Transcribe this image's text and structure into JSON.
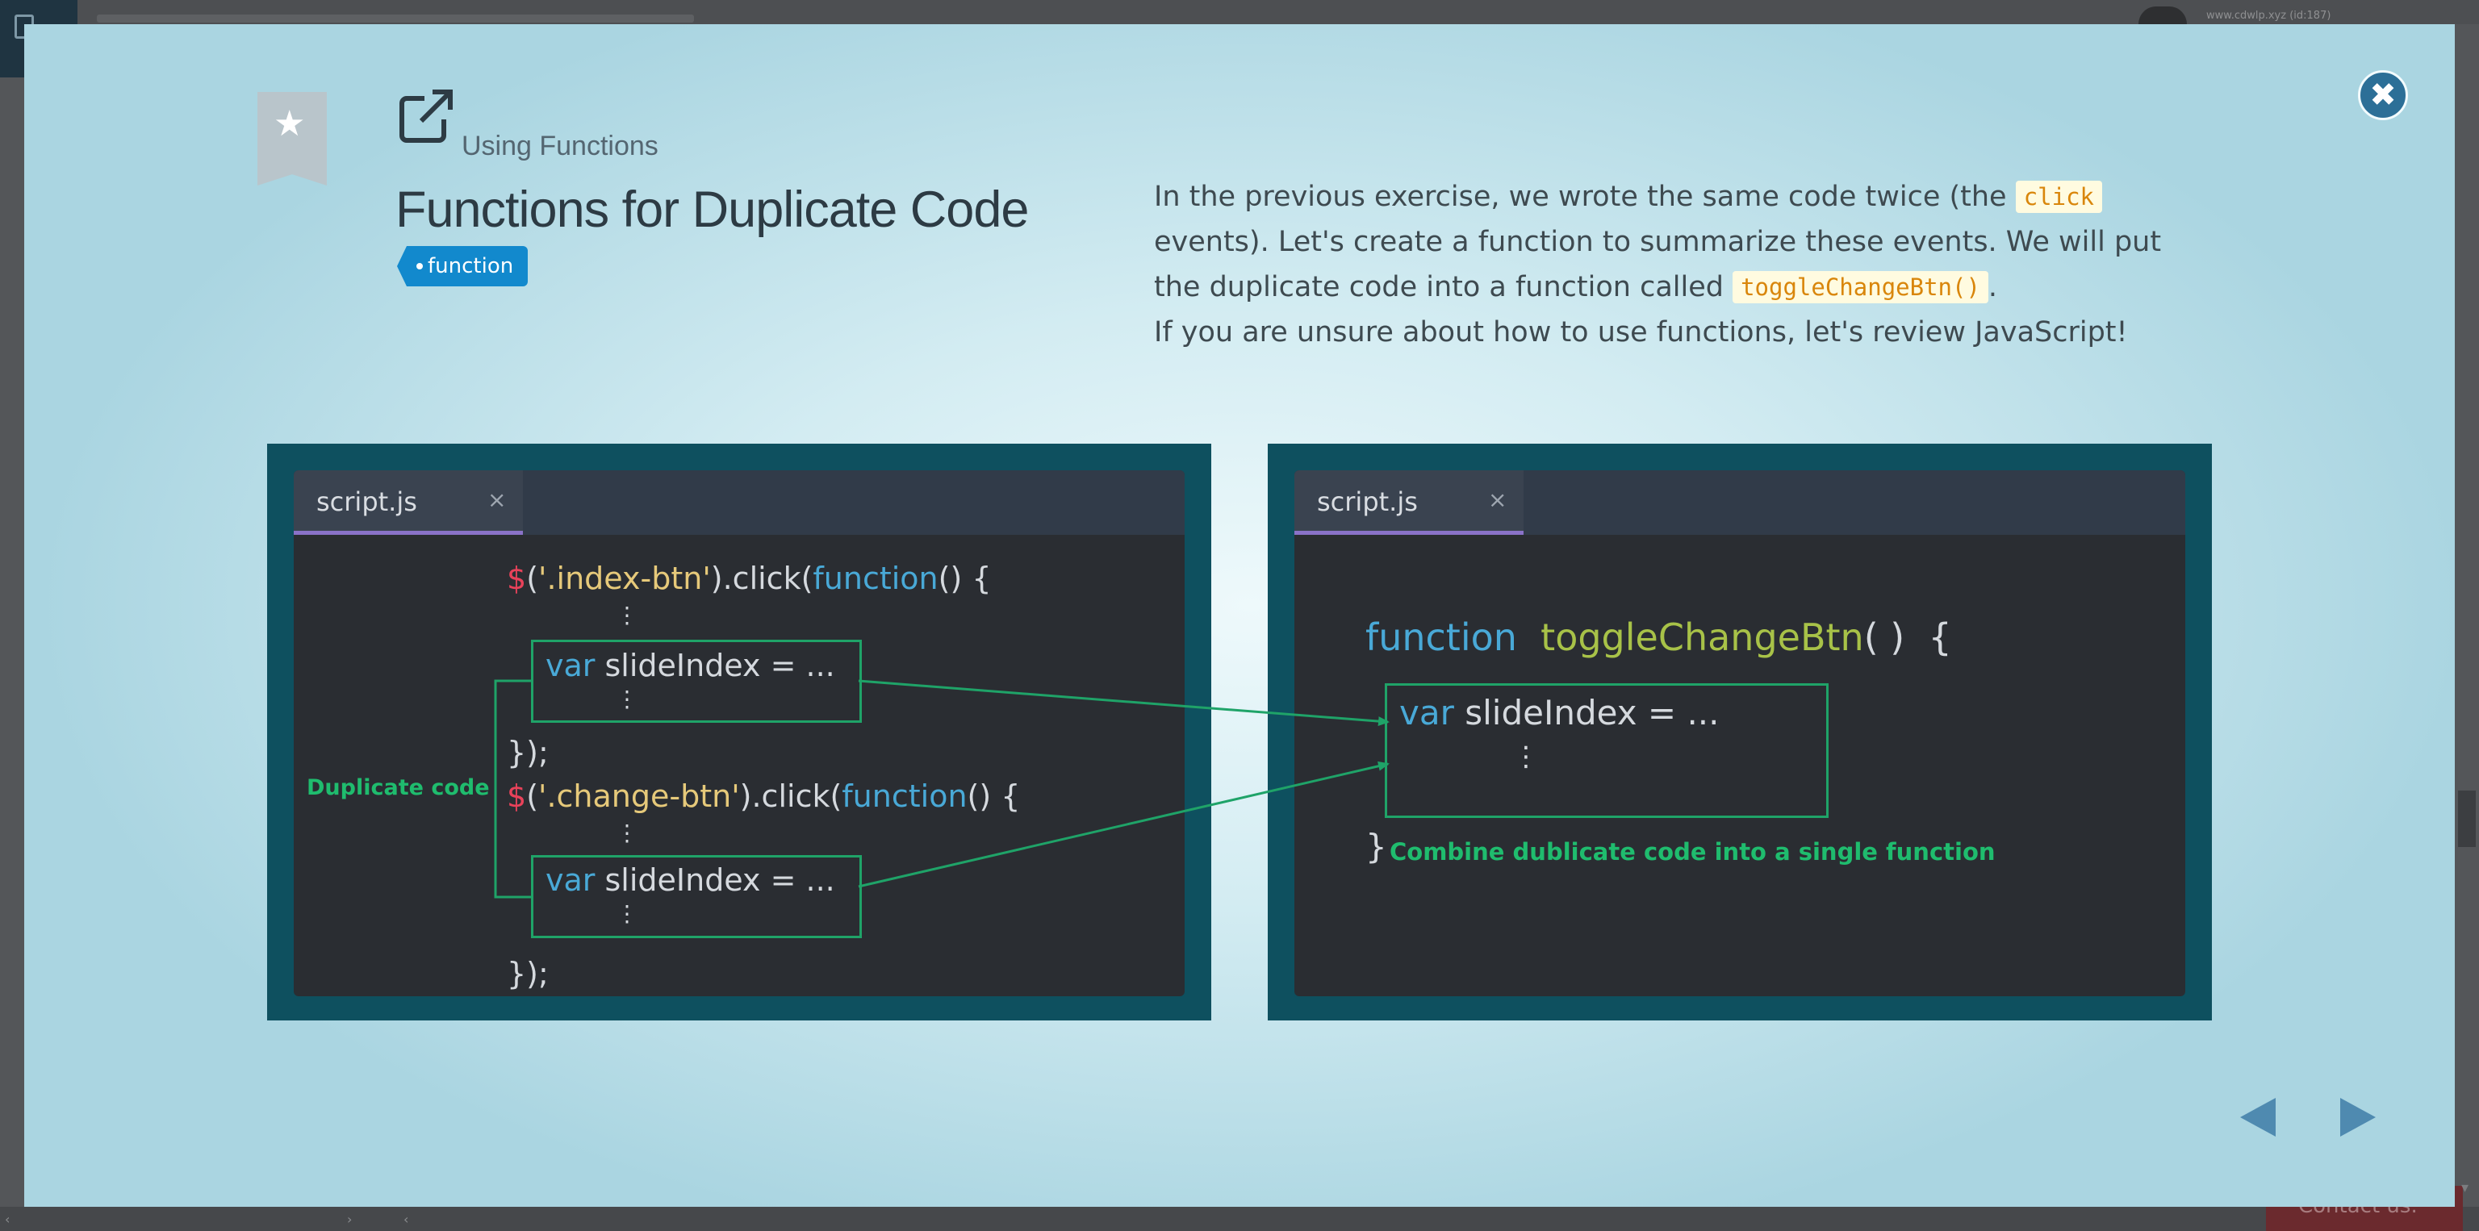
{
  "background": {
    "user_text": "www.cdwlp.xyz (id:187)",
    "contact_label": "Contact us."
  },
  "lesson": {
    "section": "Using Functions",
    "title": "Functions for Duplicate Code",
    "tag": "function",
    "description": {
      "part1": "In the previous exercise, we wrote the same code twice (the ",
      "code1": "click",
      "part2": " events). Let's create a function to summarize these events. We will put the duplicate code into a function called ",
      "code2": "toggleChangeBtn()",
      "part3": ".",
      "line2": "If you are unsure about how to use functions, let's review JavaScript!"
    }
  },
  "left_editor": {
    "tab": "script.js",
    "tab_close": "×",
    "line1": {
      "dollar": "$",
      "open": "(",
      "selector": "'.index-btn'",
      "mid": ").click(",
      "kw": "function",
      "end": "() {"
    },
    "box_line": {
      "kw": "var",
      "rest": " slideIndex = ..."
    },
    "close1": "});",
    "line2": {
      "dollar": "$",
      "open": "(",
      "selector": "'.change-btn'",
      "mid": ").click(",
      "kw": "function",
      "end": "() {"
    },
    "close2": "});",
    "dup_label": "Duplicate code",
    "vdots": "⋮"
  },
  "right_editor": {
    "tab": "script.js",
    "tab_close": "×",
    "fn_kw": "function",
    "fn_name": "toggleChangeBtn",
    "fn_end": "( )  {",
    "box_line": {
      "kw": "var",
      "rest": " slideIndex = ..."
    },
    "close": "}",
    "combine_label": "Combine dublicate code into a single function",
    "vdots": "⋮"
  },
  "controls": {
    "close_glyph": "✖"
  },
  "colors": {
    "accent": "#2c6f97",
    "tag": "#1289cd",
    "dup_green": "#1fa368",
    "editor_bg": "#2a2d32",
    "frame": "#0e505f"
  }
}
